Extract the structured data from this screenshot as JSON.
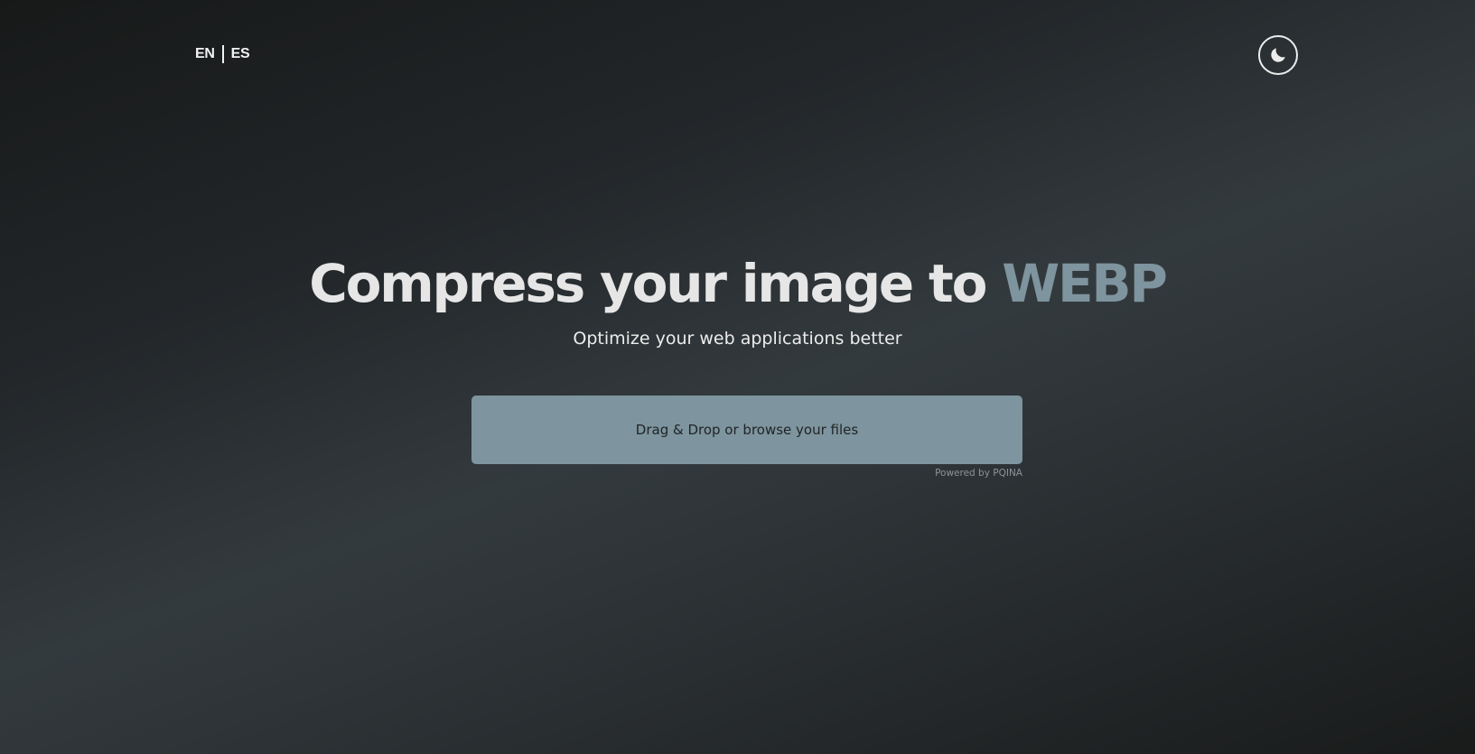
{
  "header": {
    "languages": [
      "EN",
      "ES"
    ],
    "theme_toggle_icon": "moon-icon"
  },
  "hero": {
    "title_main": "Compress your image to ",
    "title_accent": "WEBP",
    "subtitle": "Optimize your web applications better"
  },
  "uploader": {
    "label_prefix": "Drag & Drop or ",
    "browse_label": "browse",
    "label_suffix": " your files",
    "credit": "Powered by PQINA"
  },
  "colors": {
    "accent": "#7e949e",
    "text": "#e6e6e6",
    "background_dark": "#1a1c1c",
    "background_light": "#333a3e"
  }
}
